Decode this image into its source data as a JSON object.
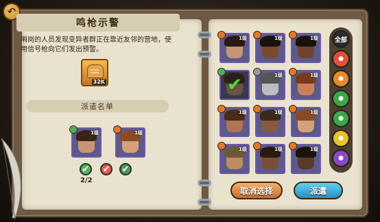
{
  "window": {
    "title": "鸣枪示警",
    "description": "哨岗的人员发现变异者群正在靠近友邻的营地，使用信号枪向它们发出预警。"
  },
  "reward": {
    "icon": "bread-icon",
    "quantity": "32K"
  },
  "dispatch": {
    "header": "派遣名单",
    "selected": [
      {
        "level": "1级",
        "badge": "green",
        "skin": "#c79574",
        "hair": "#3b2417"
      },
      {
        "level": "1级",
        "badge": "orange",
        "skin": "#d5a07a",
        "hair": "#8a4a22"
      }
    ],
    "requirements": [
      {
        "icon": "check-icon",
        "count": "2/2"
      },
      {
        "icon": "check-icon",
        "count": ""
      },
      {
        "icon": "check-icon",
        "count": ""
      }
    ]
  },
  "roster": [
    {
      "level": "1级",
      "badge": "orange",
      "skin": "#c79574",
      "hair": "#2a1a12",
      "state": "normal"
    },
    {
      "level": "1级",
      "badge": "orange",
      "skin": "#7a4a2e",
      "hair": "#1a120c",
      "state": "normal"
    },
    {
      "level": "1级",
      "badge": "orange",
      "skin": "#6e452c",
      "hair": "#1a120c",
      "state": "normal"
    },
    {
      "level": "",
      "badge": "green",
      "skin": "#c79574",
      "hair": "#3b2417",
      "state": "selected"
    },
    {
      "level": "1级",
      "badge": "grey",
      "skin": "#bdbdbd",
      "hair": "#555555",
      "state": "gray"
    },
    {
      "level": "1级",
      "badge": "orange",
      "skin": "#c9805a",
      "hair": "#7a3a1a",
      "state": "normal"
    },
    {
      "level": "1级",
      "badge": "orange",
      "skin": "#b07550",
      "hair": "#4a2a18",
      "state": "normal"
    },
    {
      "level": "1级",
      "badge": "orange",
      "skin": "#8a5a3e",
      "hair": "#3a2a1e",
      "state": "normal"
    },
    {
      "level": "1级",
      "badge": "orange",
      "skin": "#d5a07a",
      "hair": "#8a4a22",
      "state": "normal"
    },
    {
      "level": "1级",
      "badge": "orange",
      "skin": "#c08a62",
      "hair": "#6a5a3a",
      "state": "normal"
    },
    {
      "level": "1级",
      "badge": "orange",
      "skin": "#7a4f38",
      "hair": "#2a1a12",
      "state": "normal"
    },
    {
      "level": "1级",
      "badge": "orange",
      "skin": "#5a3a28",
      "hair": "#1a1210",
      "state": "normal"
    }
  ],
  "filters": [
    {
      "label": "全部",
      "icon": "all-filter",
      "color": "#2b2b2b"
    },
    {
      "label": "",
      "icon": "arrow-down-icon",
      "color": "#e0503a"
    },
    {
      "label": "",
      "icon": "fist-icon",
      "color": "#e88a2a"
    },
    {
      "label": "",
      "icon": "leaf-icon",
      "color": "#3aa84a"
    },
    {
      "label": "",
      "icon": "mask-icon",
      "color": "#3aa84a"
    },
    {
      "label": "",
      "icon": "crown-icon",
      "color": "#e8c22a"
    },
    {
      "label": "",
      "icon": "skull-icon",
      "color": "#8a4ac8"
    }
  ],
  "buttons": {
    "cancel": "取消选择",
    "send": "派遣"
  },
  "colors": {
    "accent_orange": "#e2782c",
    "accent_blue": "#2a8cc4",
    "check_green": "#5fd33a"
  }
}
